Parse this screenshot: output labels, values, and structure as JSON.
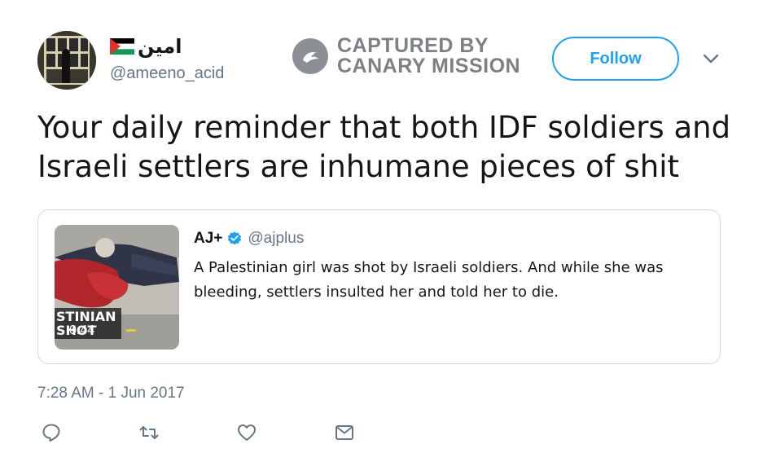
{
  "author": {
    "display_name": "امين",
    "handle": "@ameeno_acid",
    "flag_icon": "palestine-flag-icon"
  },
  "watermark": {
    "line1": "CAPTURED BY",
    "line2": "CANARY MISSION",
    "logo_icon": "canary-bird-icon"
  },
  "follow_button": {
    "label": "Follow"
  },
  "tweet": {
    "text": "Your daily reminder that both IDF soldiers and Israeli settlers are inhumane pieces of shit",
    "timestamp": "7:28 AM - 1 Jun 2017"
  },
  "quoted_tweet": {
    "name": "AJ+",
    "verified": true,
    "handle": "@ajplus",
    "text": "A Palestinian girl was shot by Israeli soldiers. And while she was bleeding, settlers insulted her and told her to die.",
    "thumbnail": {
      "caption_line1": "STINIAN",
      "caption_line2": "SHOT",
      "duration": "0:44"
    }
  },
  "actions": [
    {
      "icon": "reply-icon"
    },
    {
      "icon": "retweet-icon"
    },
    {
      "icon": "like-heart-icon"
    },
    {
      "icon": "direct-message-icon"
    }
  ],
  "colors": {
    "accent": "#1da1f2",
    "text": "#14171a",
    "secondary": "#657786",
    "border": "#cfd9de",
    "watermark": "#7d8185"
  }
}
